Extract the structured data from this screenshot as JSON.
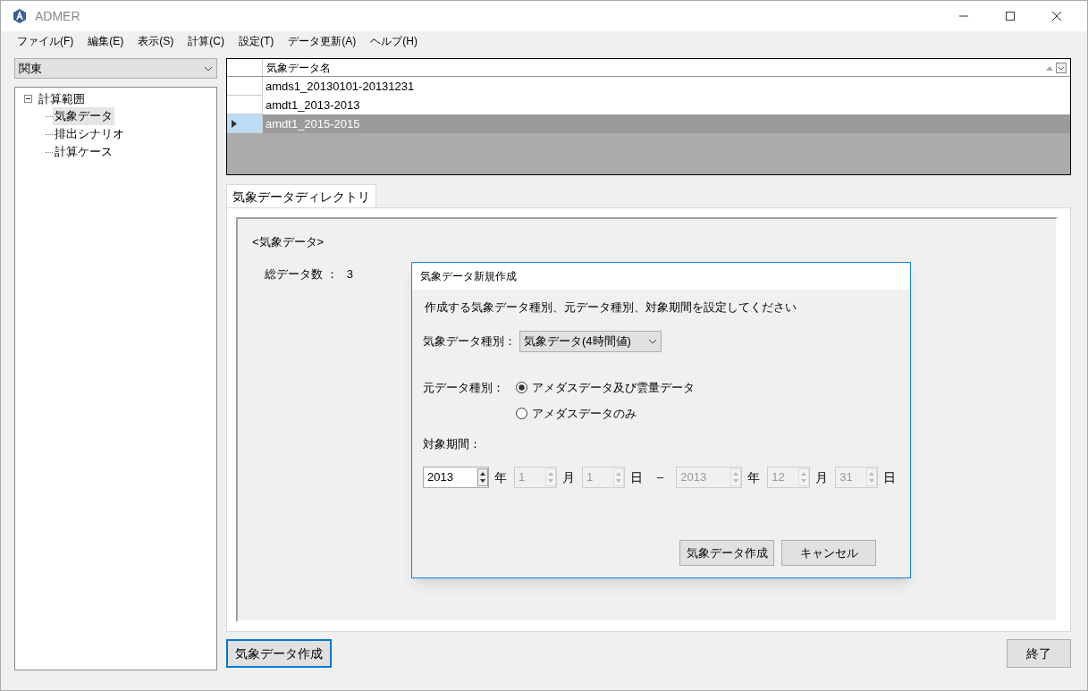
{
  "window": {
    "title": "ADMER"
  },
  "menu": [
    "ファイル(F)",
    "編集(E)",
    "表示(S)",
    "計算(C)",
    "設定(T)",
    "データ更新(A)",
    "ヘルプ(H)"
  ],
  "region_select": {
    "value": "関東"
  },
  "tree": [
    {
      "label": "計算範囲",
      "expanded": true,
      "selected": false,
      "children": [
        {
          "label": "気象データ",
          "selected": true
        },
        {
          "label": "排出シナリオ",
          "selected": false
        },
        {
          "label": "計算ケース",
          "selected": false
        }
      ]
    }
  ],
  "grid": {
    "columns": [
      "気象データ名"
    ],
    "rows": [
      {
        "name": "amds1_20130101-20131231",
        "selected": false
      },
      {
        "name": "amdt1_2013-2013",
        "selected": false
      },
      {
        "name": "amdt1_2015-2015",
        "selected": true
      }
    ]
  },
  "tabs": [
    {
      "label": "気象データディレクトリ",
      "selected": true
    }
  ],
  "panel": {
    "heading": "<気象データ>",
    "count_label": "総データ数 ：",
    "count_value": "3"
  },
  "dialog": {
    "title": "気象データ新規作成",
    "instruction": "作成する気象データ種別、元データ種別、対象期間を設定してください",
    "type_label": "気象データ種別：",
    "type_value": "気象データ(4時間値)",
    "source_label": "元データ種別：",
    "sources": [
      {
        "label": "アメダスデータ及び雲量データ",
        "selected": true
      },
      {
        "label": "アメダスデータのみ",
        "selected": false
      }
    ],
    "period_label": "対象期間：",
    "period": [
      {
        "kind": "spin",
        "value": "2013",
        "disabled": false,
        "unit": "年"
      },
      {
        "kind": "spin",
        "value": "1",
        "disabled": true,
        "unit": "月"
      },
      {
        "kind": "spin",
        "value": "1",
        "disabled": true,
        "unit": "日"
      },
      {
        "kind": "dash",
        "text": "–"
      },
      {
        "kind": "spin",
        "value": "2013",
        "disabled": true,
        "unit": "年"
      },
      {
        "kind": "spin",
        "value": "12",
        "disabled": true,
        "unit": "月"
      },
      {
        "kind": "spin",
        "value": "31",
        "disabled": true,
        "unit": "日"
      }
    ],
    "buttons": [
      "気象データ作成",
      "キャンセル"
    ]
  },
  "footer": {
    "create_button": "気象データ作成",
    "exit_button": "終了"
  }
}
